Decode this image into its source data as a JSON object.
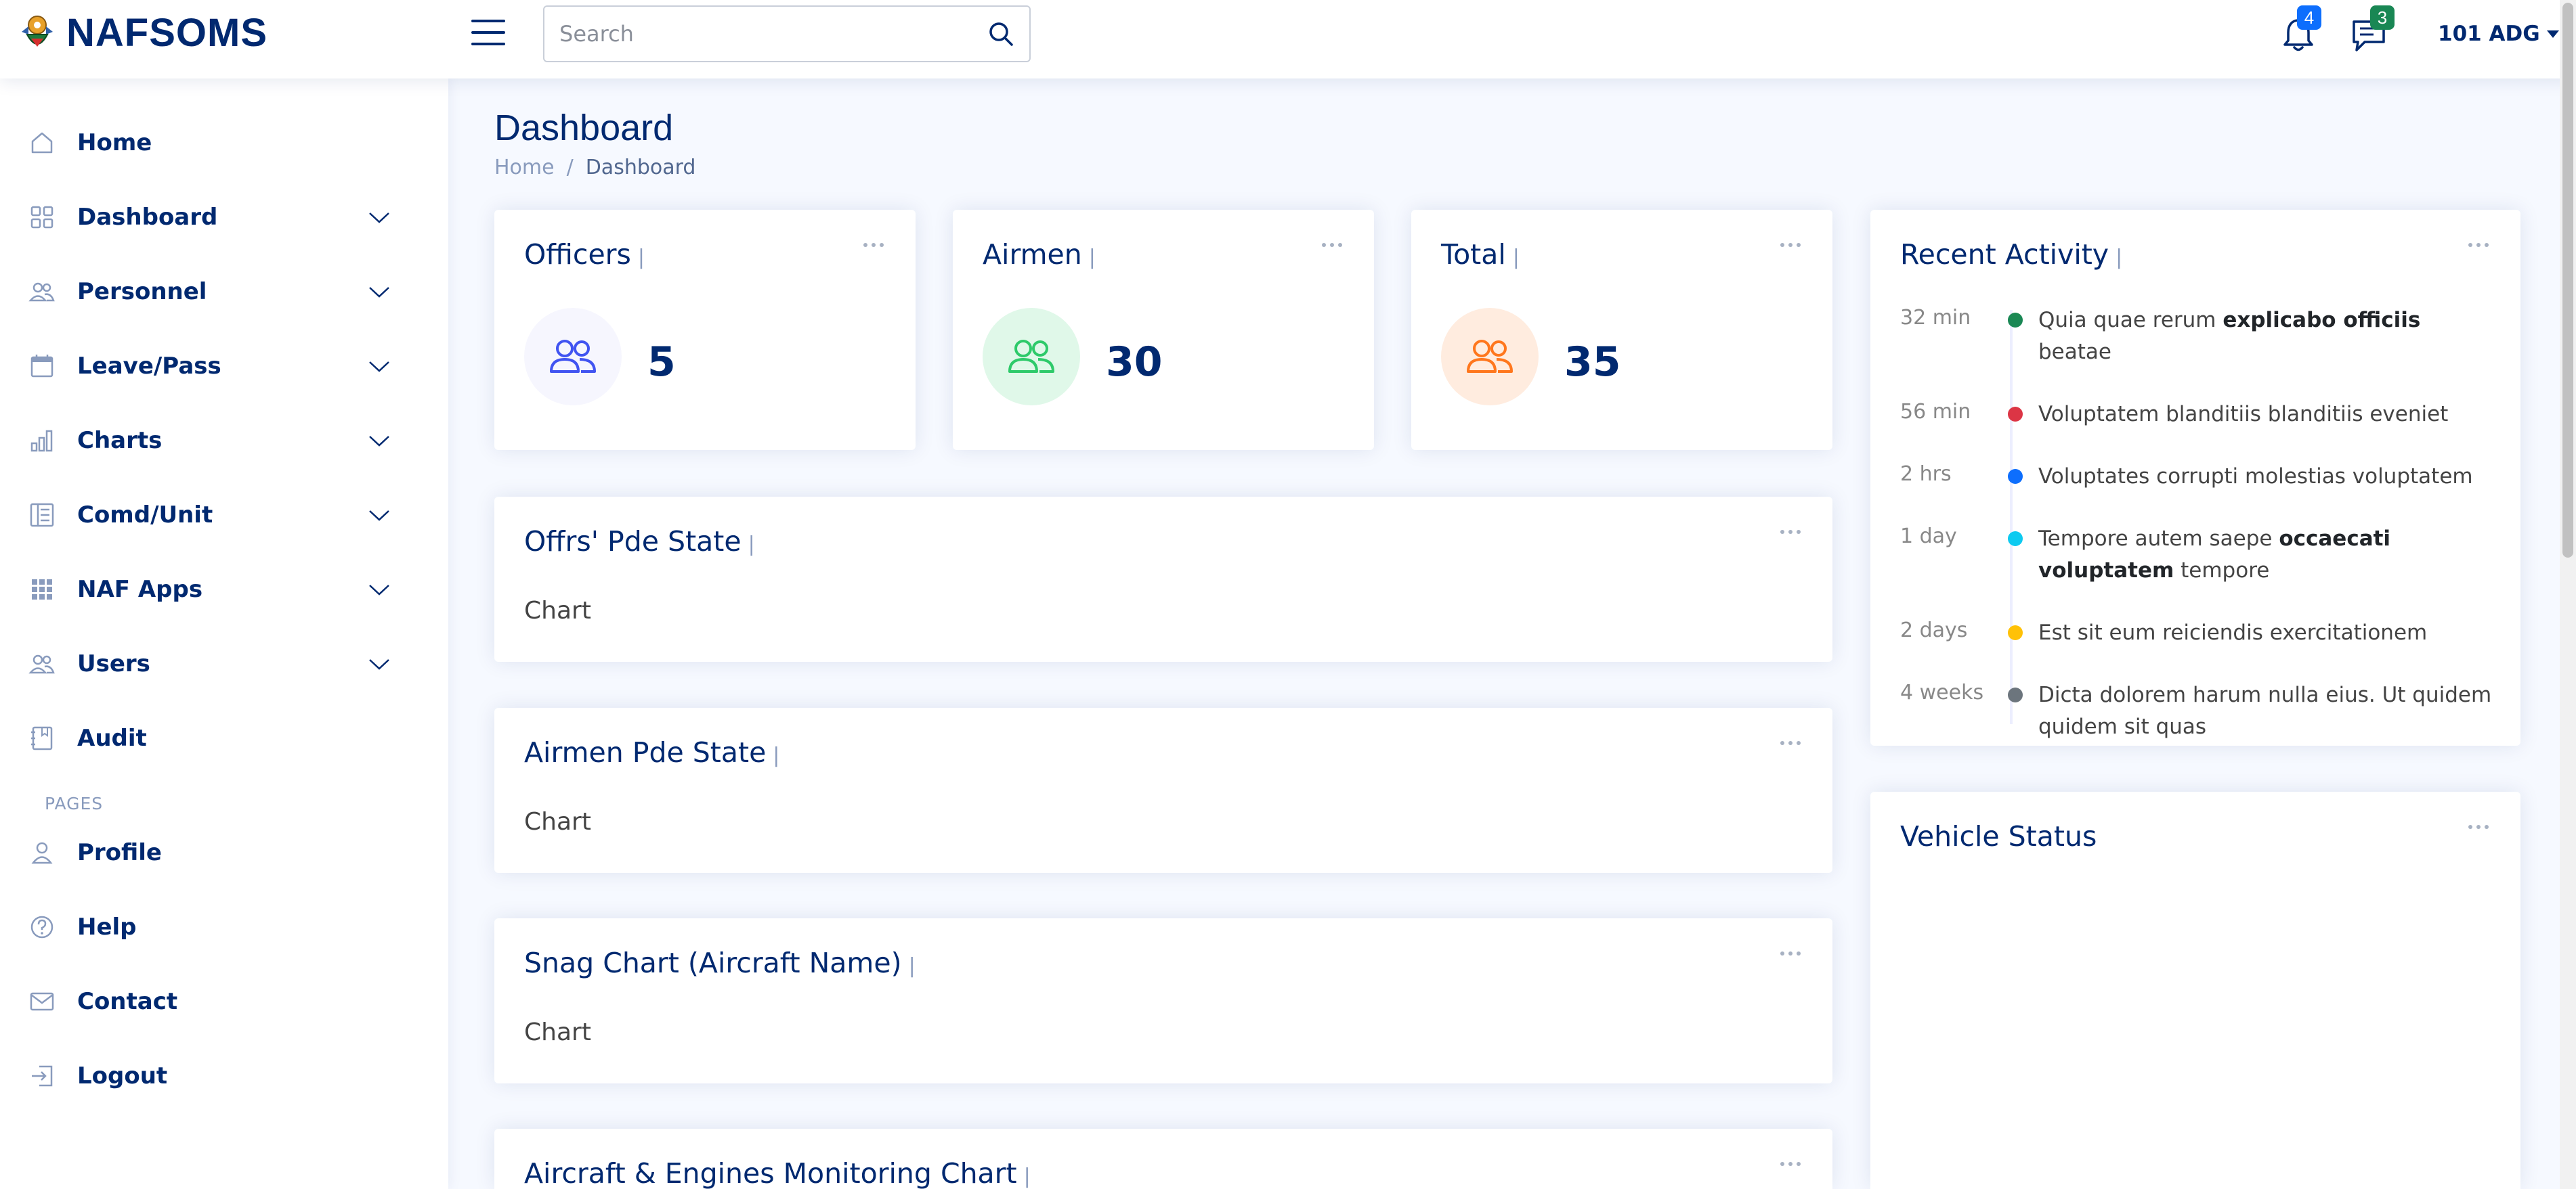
{
  "header": {
    "logo_text": "NAFSOMS",
    "search_placeholder": "Search",
    "notifications_count": "4",
    "messages_count": "3",
    "user_label": "101 ADG"
  },
  "sidebar": {
    "items": [
      {
        "label": "Home",
        "icon": "home-icon",
        "expandable": false
      },
      {
        "label": "Dashboard",
        "icon": "grid-icon",
        "expandable": true
      },
      {
        "label": "Personnel",
        "icon": "people-icon",
        "expandable": true
      },
      {
        "label": "Leave/Pass",
        "icon": "calendar-icon",
        "expandable": true
      },
      {
        "label": "Charts",
        "icon": "bar-chart-icon",
        "expandable": true
      },
      {
        "label": "Comd/Unit",
        "icon": "layout-text-icon",
        "expandable": true
      },
      {
        "label": "NAF Apps",
        "icon": "apps-grid-icon",
        "expandable": true
      },
      {
        "label": "Users",
        "icon": "people-icon",
        "expandable": true
      },
      {
        "label": "Audit",
        "icon": "journal-icon",
        "expandable": false
      }
    ],
    "pages_heading": "PAGES",
    "pages": [
      {
        "label": "Profile",
        "icon": "person-icon"
      },
      {
        "label": "Help",
        "icon": "question-circle-icon"
      },
      {
        "label": "Contact",
        "icon": "envelope-icon"
      },
      {
        "label": "Logout",
        "icon": "logout-icon"
      }
    ]
  },
  "main": {
    "page_title": "Dashboard",
    "breadcrumb": {
      "home": "Home",
      "separator": "/",
      "current": "Dashboard"
    },
    "stats": [
      {
        "title": "Officers",
        "value": "5",
        "color": "#4154f1",
        "bg": "#f6f6fe"
      },
      {
        "title": "Airmen",
        "value": "30",
        "color": "#2eca6a",
        "bg": "#e0f8e9"
      },
      {
        "title": "Total",
        "value": "35",
        "color": "#ff771d",
        "bg": "#ffecdf"
      }
    ],
    "title_separator": "|",
    "chart_cards": [
      {
        "title": "Offrs' Pde State",
        "body": "Chart"
      },
      {
        "title": "Airmen Pde State",
        "body": "Chart"
      },
      {
        "title": "Snag Chart (Aircraft Name)",
        "body": "Chart"
      },
      {
        "title": "Aircraft & Engines Monitoring Chart",
        "body": ""
      }
    ],
    "recent_activity": {
      "title": "Recent Activity",
      "items": [
        {
          "time": "32 min",
          "color": "#198754",
          "before": "Quia quae rerum ",
          "bold": "explicabo officiis",
          "after": " beatae"
        },
        {
          "time": "56 min",
          "color": "#dc3545",
          "before": "Voluptatem blanditiis blanditiis eveniet",
          "bold": "",
          "after": ""
        },
        {
          "time": "2 hrs",
          "color": "#0d6efd",
          "before": "Voluptates corrupti molestias voluptatem",
          "bold": "",
          "after": ""
        },
        {
          "time": "1 day",
          "color": "#0dcaf0",
          "before": "Tempore autem saepe ",
          "bold": "occaecati voluptatem",
          "after": " tempore"
        },
        {
          "time": "2 days",
          "color": "#ffc107",
          "before": "Est sit eum reiciendis exercitationem",
          "bold": "",
          "after": ""
        },
        {
          "time": "4 weeks",
          "color": "#6c757d",
          "before": "Dicta dolorem harum nulla eius. Ut quidem quidem sit quas",
          "bold": "",
          "after": ""
        }
      ]
    },
    "vehicle_status": {
      "title": "Vehicle Status"
    }
  }
}
